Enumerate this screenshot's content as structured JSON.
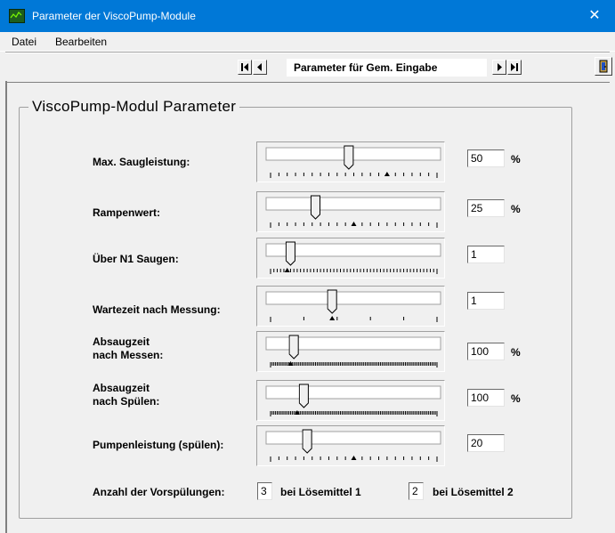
{
  "window": {
    "title": "Parameter der ViscoPump-Module",
    "close_glyph": "✕"
  },
  "menu": [
    "Datei",
    "Bearbeiten"
  ],
  "toolbar": {
    "record_label": "Parameter für Gem. Eingabe",
    "icons": [
      "first-record-icon",
      "prev-record-icon",
      "next-record-icon",
      "last-record-icon",
      "exit-door-icon"
    ]
  },
  "group": {
    "title": "ViscoPump-Modul Parameter"
  },
  "params": [
    {
      "label": "Max. Saugleistung:",
      "value": "50",
      "unit": "%",
      "position_fraction": 0.47,
      "ticks": 20,
      "marker_fraction": 0.7
    },
    {
      "label": "Rampenwert:",
      "value": "25",
      "unit": "%",
      "position_fraction": 0.27,
      "ticks": 20,
      "marker_fraction": 0.5
    },
    {
      "label": "Über N1 Saugen:",
      "value": "1",
      "unit": "",
      "position_fraction": 0.12,
      "ticks": 50,
      "marker_fraction": 0.1
    },
    {
      "label": "Wartezeit nach Messung:",
      "value": "1",
      "unit": "",
      "position_fraction": 0.37,
      "ticks": 5,
      "marker_fraction": 0.37
    },
    {
      "label_line1": "Absaugzeit",
      "label_line2": "nach Messen:",
      "value": "100",
      "unit": "%",
      "position_fraction": 0.14,
      "ticks": 100,
      "marker_fraction": 0.12
    },
    {
      "label_line1": "Absaugzeit",
      "label_line2": "nach Spülen:",
      "value": "100",
      "unit": "%",
      "position_fraction": 0.2,
      "ticks": 100,
      "marker_fraction": 0.16
    },
    {
      "label": "Pumpenleistung (spülen):",
      "value": "20",
      "unit": "",
      "position_fraction": 0.22,
      "ticks": 20,
      "marker_fraction": 0.5
    }
  ],
  "rinse": {
    "label": "Anzahl der Vorspülungen:",
    "solvent1_value": "3",
    "solvent1_label": "bei Lösemittel 1",
    "solvent2_value": "2",
    "solvent2_label": "bei Lösemittel 2"
  }
}
